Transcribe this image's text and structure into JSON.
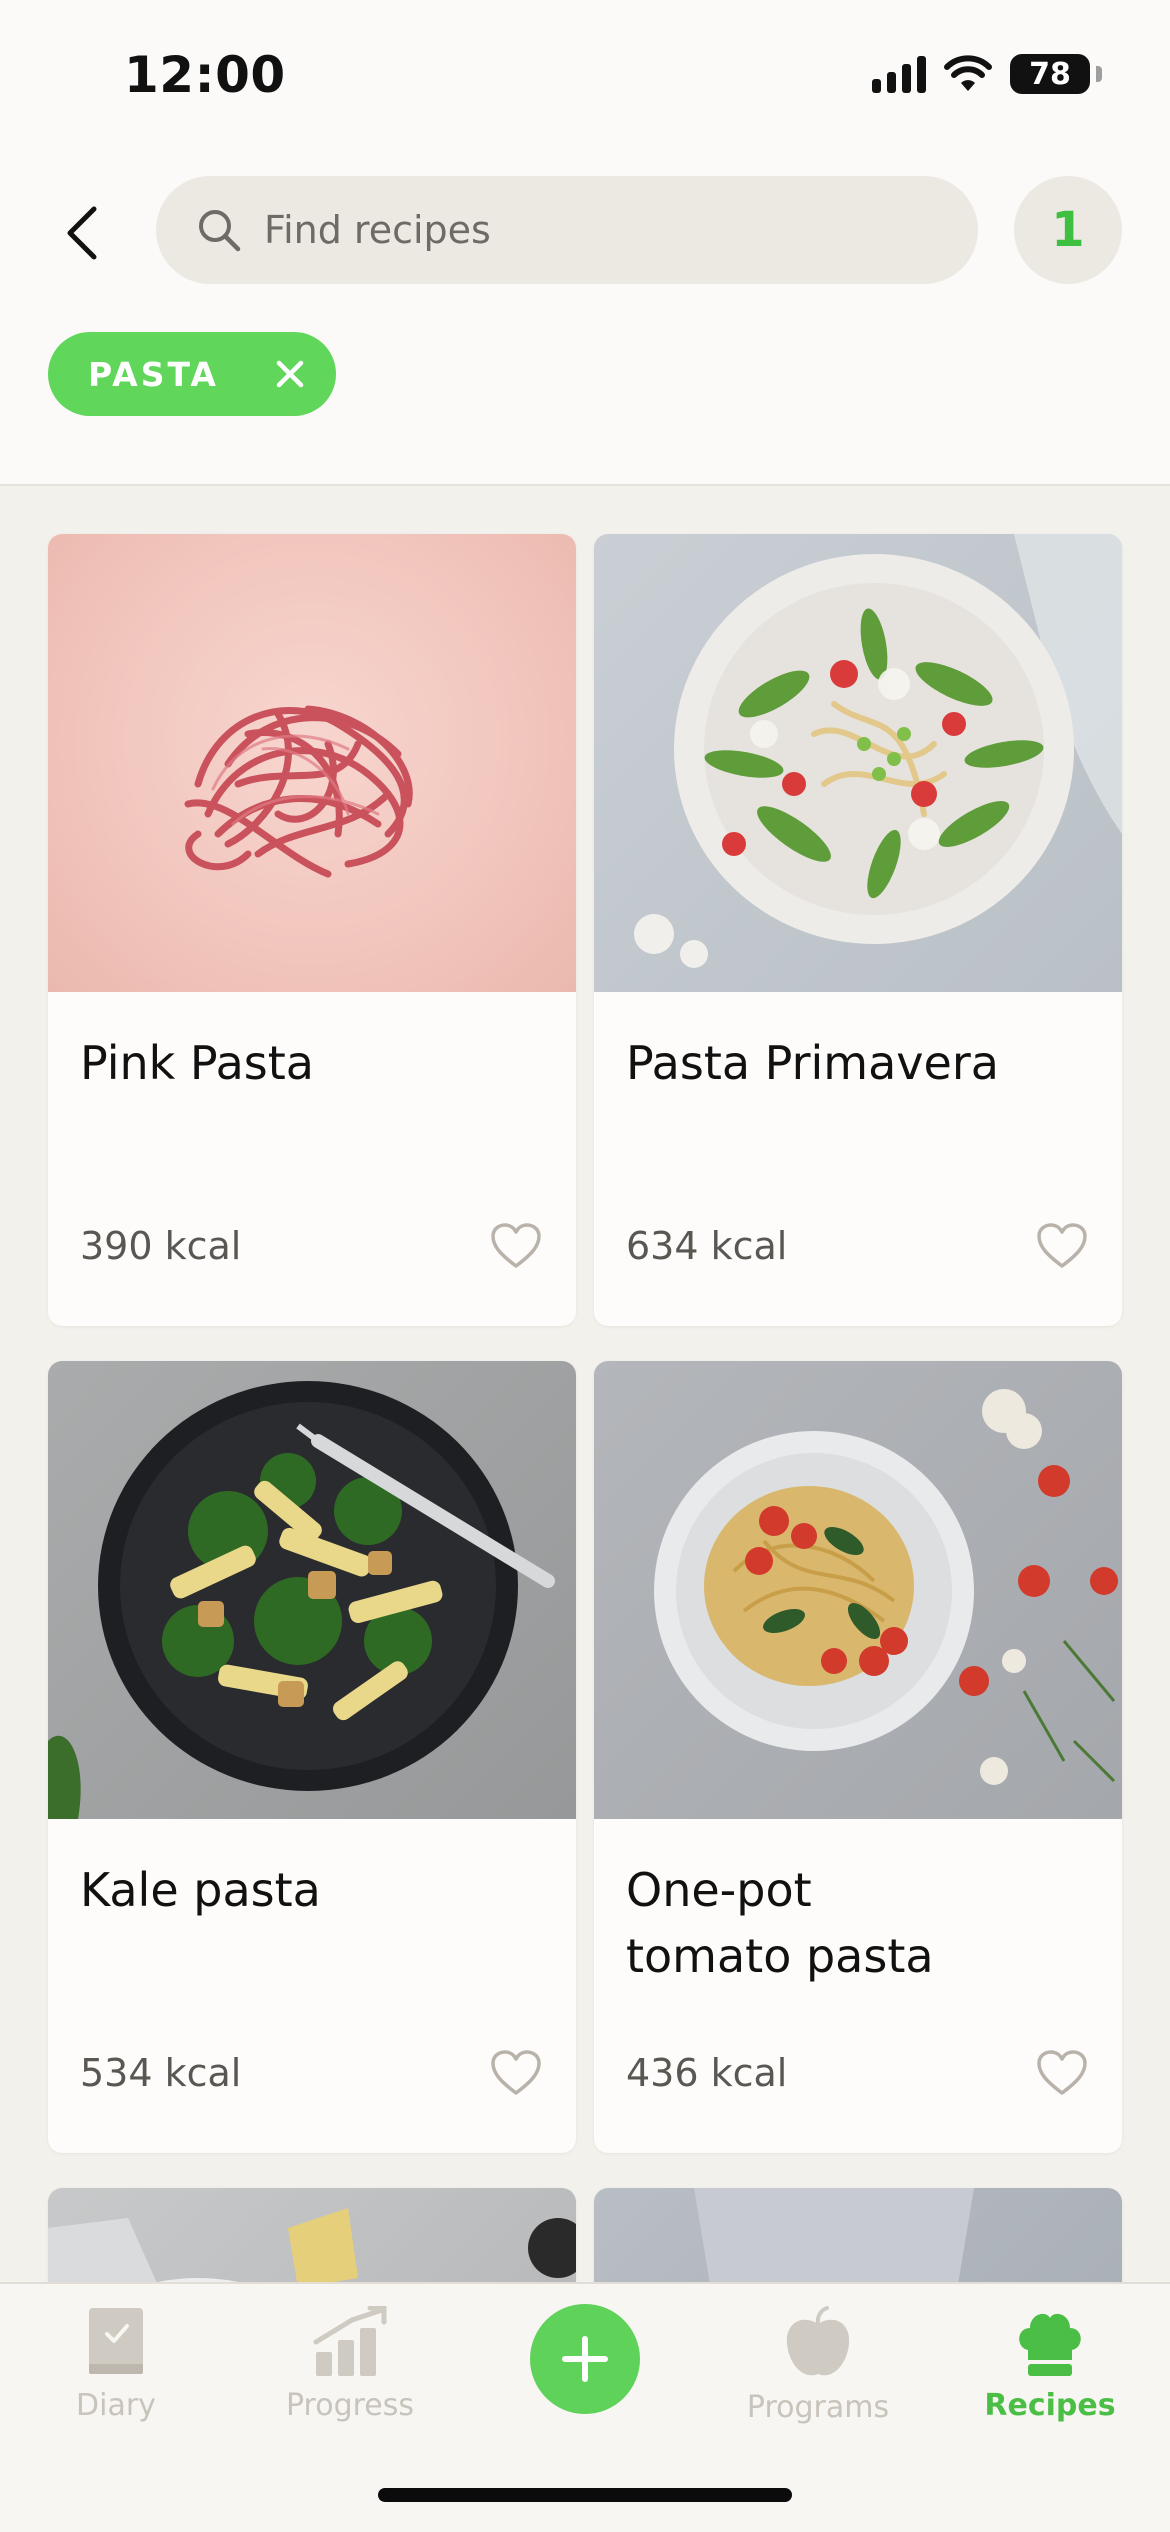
{
  "status_bar": {
    "time": "12:00",
    "battery": "78"
  },
  "search": {
    "placeholder": "Find recipes"
  },
  "filter_count": "1",
  "active_filter": {
    "label": "PASTA"
  },
  "recipes": [
    {
      "title": "Pink Pasta",
      "kcal": "390 kcal"
    },
    {
      "title": "Pasta Primavera",
      "kcal": "634 kcal"
    },
    {
      "title": "Kale pasta",
      "kcal": "534 kcal"
    },
    {
      "title": "One-pot\ntomato pasta",
      "kcal": "436 kcal"
    }
  ],
  "tabbar": {
    "diary": "Diary",
    "progress": "Progress",
    "programs": "Programs",
    "recipes": "Recipes"
  },
  "colors": {
    "accent": "#5fd25a",
    "accent_text": "#4bbf45",
    "inactive_tab": "#c8c3bb"
  }
}
